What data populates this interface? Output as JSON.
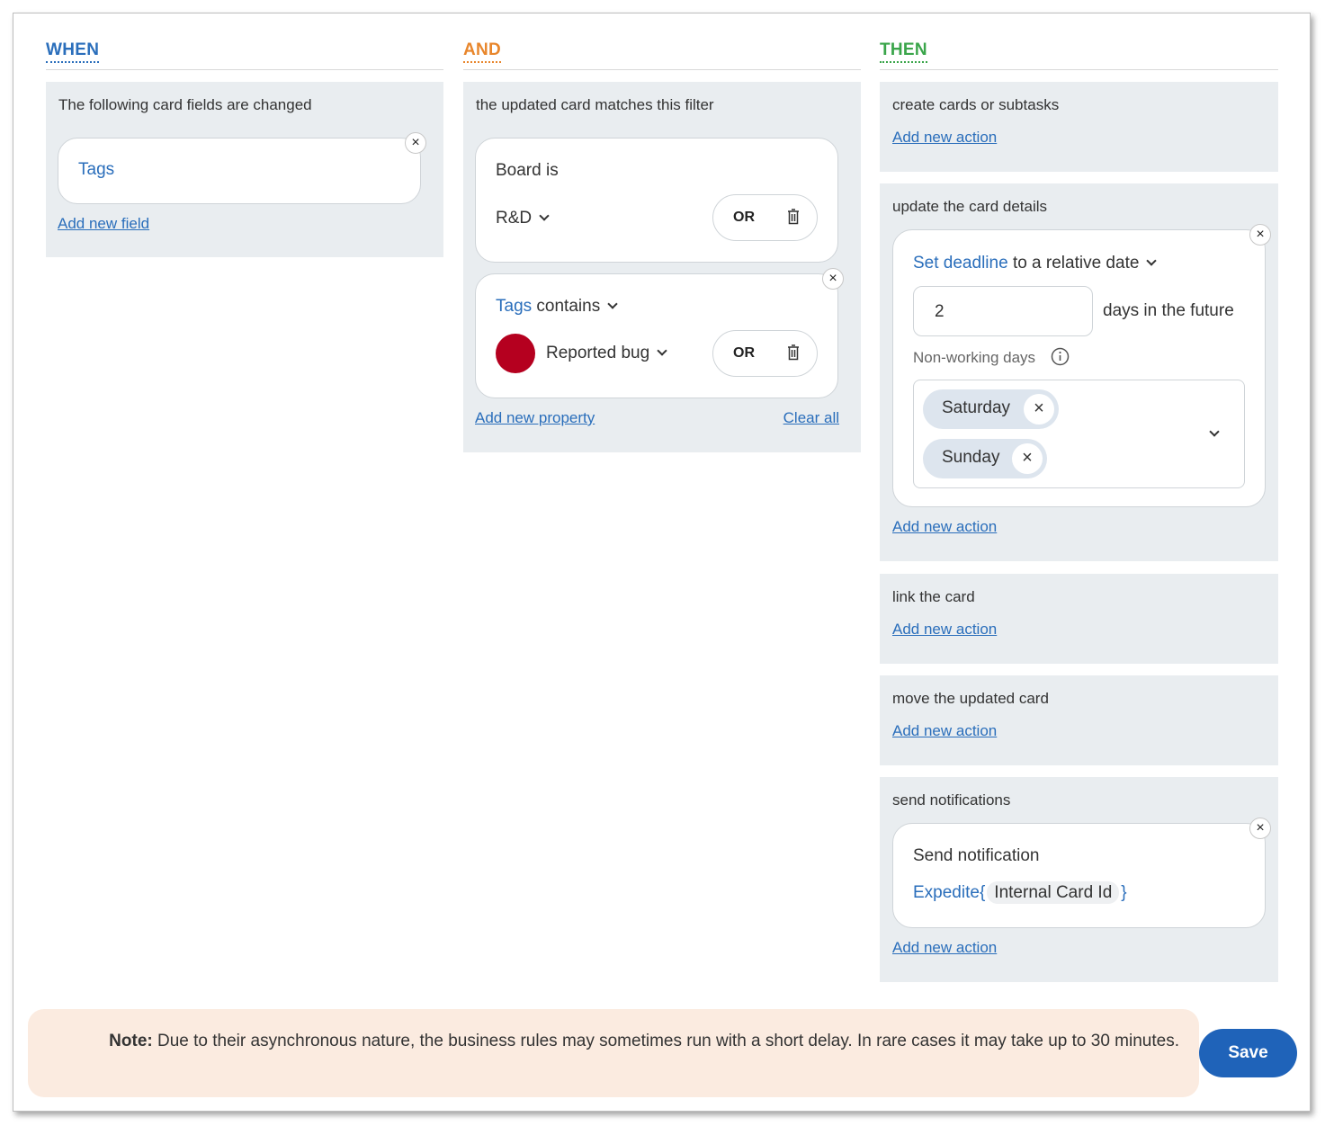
{
  "columns": {
    "when": {
      "title": "WHEN",
      "color": "#2a6ebb"
    },
    "and": {
      "title": "AND",
      "color": "#e8862c"
    },
    "then": {
      "title": "THEN",
      "color": "#3aa54a"
    }
  },
  "when_panel": {
    "title": "The following card fields are changed",
    "field": "Tags",
    "add_link": "Add new field"
  },
  "and_panel": {
    "title": "the updated card matches this filter",
    "filter1": {
      "label": "Board is",
      "value": "R&D",
      "or": "OR"
    },
    "filter2": {
      "field": "Tags",
      "operator": "contains",
      "value": "Reported bug",
      "tag_color": "#b5001f",
      "or": "OR"
    },
    "add_link": "Add new property",
    "clear_link": "Clear all"
  },
  "then_panels": {
    "create": {
      "title": "create cards or subtasks",
      "add_link": "Add new action"
    },
    "update": {
      "title": "update the card details",
      "action": "Set deadline",
      "action_rest": "to a relative date",
      "days_value": "2",
      "days_suffix": "days in the future",
      "nonworking_label": "Non-working days",
      "days": [
        "Saturday",
        "Sunday"
      ],
      "add_link": "Add new action"
    },
    "link": {
      "title": "link the card",
      "add_link": "Add new action"
    },
    "move": {
      "title": "move the updated card",
      "add_link": "Add new action"
    },
    "notify": {
      "title": "send notifications",
      "card_title": "Send notification",
      "prefix": "Expedite{",
      "token": "Internal Card Id",
      "suffix": "}",
      "add_link": "Add new action"
    }
  },
  "note": {
    "label": "Note:",
    "text": "Due to their asynchronous nature, the business rules may sometimes run with a short delay. In rare cases it may take up to 30 minutes."
  },
  "save_label": "Save",
  "close_glyph": "×"
}
